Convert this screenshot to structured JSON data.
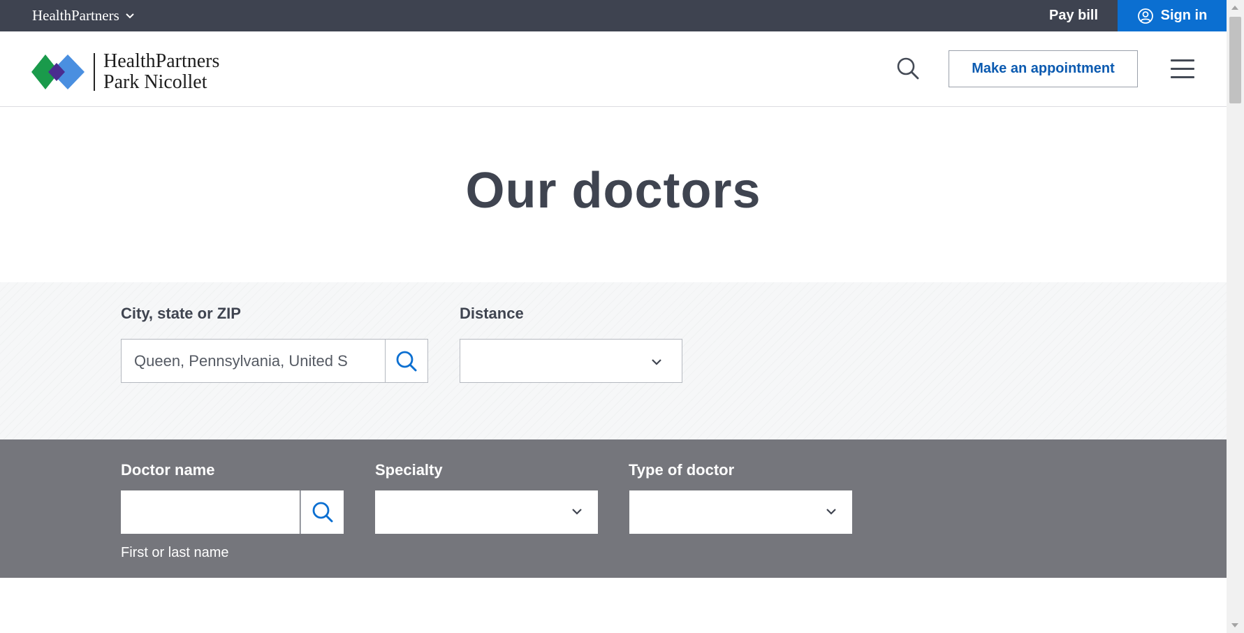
{
  "utility_bar": {
    "brand_switch_label": "HealthPartners",
    "pay_bill_label": "Pay bill",
    "sign_in_label": "Sign in"
  },
  "header": {
    "logo_line1": "HealthPartners",
    "logo_line2": "Park Nicollet",
    "appointment_label": "Make an appointment"
  },
  "main": {
    "title": "Our doctors"
  },
  "location_filters": {
    "city_label": "City, state or ZIP",
    "city_value": "Queen, Pennsylvania, United S",
    "distance_label": "Distance",
    "distance_value": ""
  },
  "doctor_filters": {
    "name_label": "Doctor name",
    "name_value": "",
    "name_helper": "First or last name",
    "specialty_label": "Specialty",
    "specialty_value": "",
    "type_label": "Type of doctor",
    "type_value": ""
  },
  "colors": {
    "utility_bar_bg": "#3e4350",
    "sign_in_bg": "#0b6fd1",
    "filter_band_bg": "#75767c",
    "link_blue": "#0b5ab0"
  }
}
